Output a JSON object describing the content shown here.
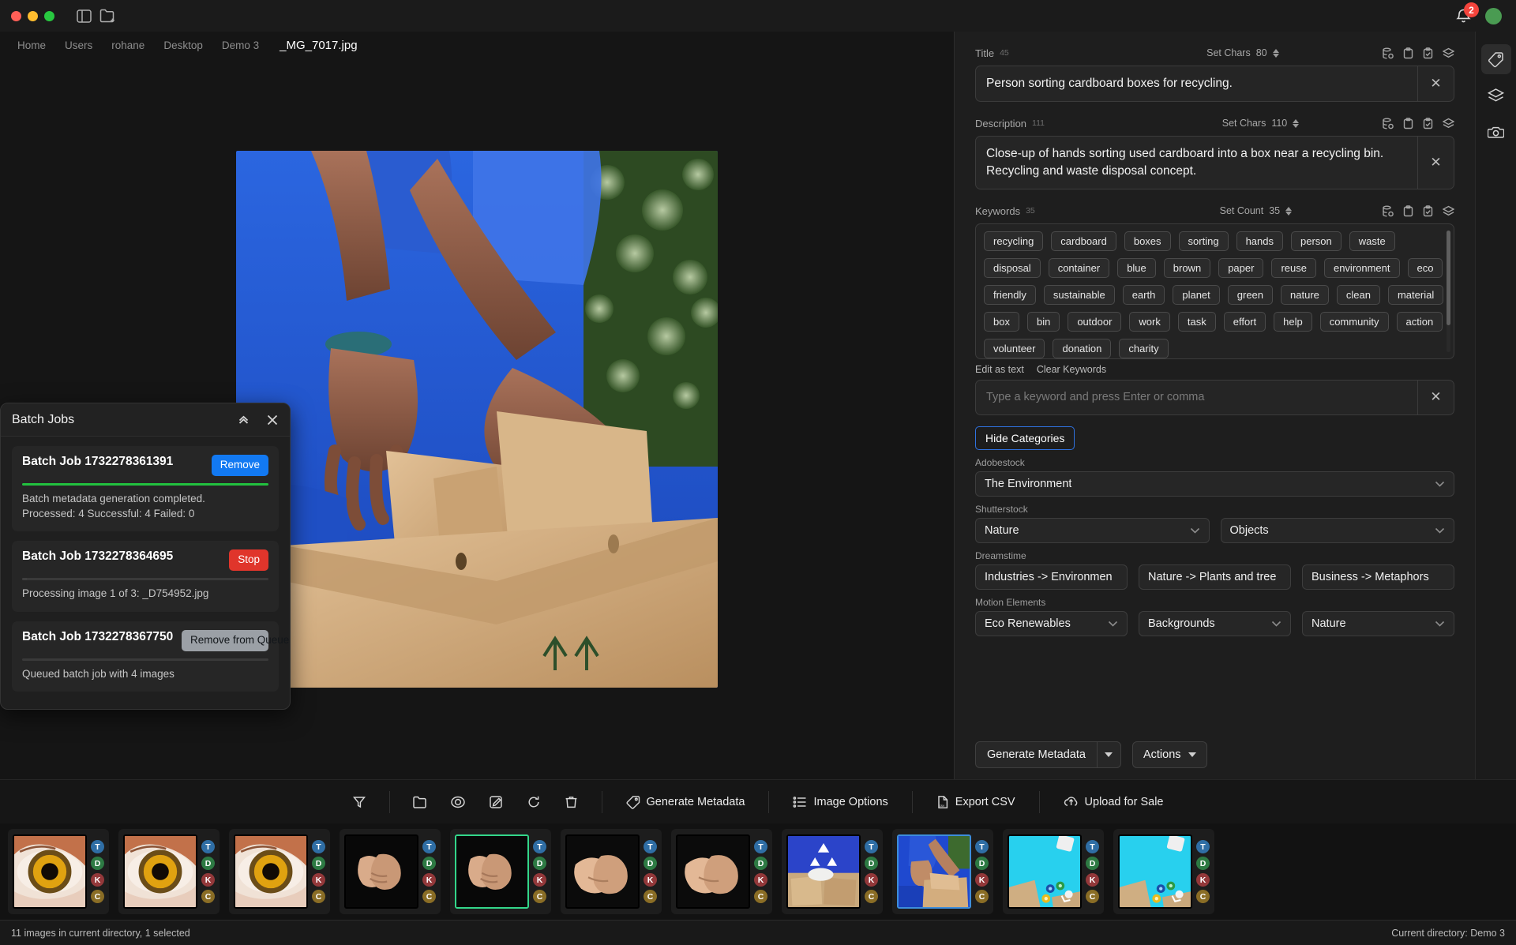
{
  "titlebar": {
    "sidebar_toggle_icon": "sidebar-panel-icon",
    "new_folder_icon": "new-folder-icon",
    "bell_icon": "bell-icon",
    "notification_count": "2"
  },
  "breadcrumb": {
    "crumbs": [
      "Home",
      "Users",
      "rohane",
      "Desktop",
      "Demo 3"
    ],
    "current": "_MG_7017.jpg"
  },
  "batch_panel": {
    "title": "Batch Jobs",
    "collapse_icon": "chevrons-up-icon",
    "close_icon": "close-icon",
    "jobs": [
      {
        "id": "Batch Job 1732278361391",
        "action_label": "Remove",
        "action_style": "blue",
        "progress": 100,
        "message": "Batch metadata generation completed.\nProcessed: 4 Successful: 4 Failed: 0"
      },
      {
        "id": "Batch Job 1732278364695",
        "action_label": "Stop",
        "action_style": "red",
        "progress": 2,
        "message": "Processing image 1 of 3: _D754952.jpg"
      },
      {
        "id": "Batch Job 1732278367750",
        "action_label": "Remove from Queue",
        "action_style": "grey",
        "progress": 0,
        "message": "Queued batch job with 4 images"
      }
    ]
  },
  "metadata": {
    "title_field": {
      "label": "Title",
      "count": "45",
      "set_label": "Set Chars",
      "set_value": "80",
      "value": "Person sorting cardboard boxes for recycling.",
      "clear_icon": "close-icon"
    },
    "description_field": {
      "label": "Description",
      "count": "111",
      "set_label": "Set Chars",
      "set_value": "110",
      "value": "Close-up of hands sorting used cardboard into a box near a recycling bin. Recycling and waste disposal concept.",
      "clear_icon": "close-icon"
    },
    "keywords_field": {
      "label": "Keywords",
      "count": "35",
      "set_label": "Set Count",
      "set_value": "35",
      "keywords": [
        "recycling",
        "cardboard",
        "boxes",
        "sorting",
        "hands",
        "person",
        "waste",
        "disposal",
        "container",
        "blue",
        "brown",
        "paper",
        "reuse",
        "environment",
        "eco",
        "friendly",
        "sustainable",
        "earth",
        "planet",
        "green",
        "nature",
        "clean",
        "material",
        "box",
        "bin",
        "outdoor",
        "work",
        "task",
        "effort",
        "help",
        "community",
        "action",
        "volunteer",
        "donation",
        "charity"
      ],
      "edit_as_text": "Edit as text",
      "clear_keywords": "Clear Keywords",
      "input_placeholder": "Type a keyword and press Enter or comma",
      "clear_icon": "close-icon"
    },
    "row_icons": [
      "database-save-icon",
      "clipboard-icon",
      "clipboard-check-icon",
      "layers-icon"
    ],
    "hide_categories_button": "Hide Categories",
    "category_groups": [
      {
        "label": "Adobestock",
        "selects": [
          {
            "value": "The Environment",
            "chevron": true
          }
        ]
      },
      {
        "label": "Shutterstock",
        "selects": [
          {
            "value": "Nature",
            "chevron": true
          },
          {
            "value": "Objects",
            "chevron": true
          }
        ]
      },
      {
        "label": "Dreamstime",
        "selects": [
          {
            "value": "Industries -> Environmen",
            "chevron": false
          },
          {
            "value": "Nature -> Plants and tree",
            "chevron": false
          },
          {
            "value": "Business -> Metaphors",
            "chevron": false
          }
        ]
      },
      {
        "label": "Motion Elements",
        "selects": [
          {
            "value": "Eco Renewables",
            "chevron": true
          },
          {
            "value": "Backgrounds",
            "chevron": true
          },
          {
            "value": "Nature",
            "chevron": true
          }
        ]
      }
    ],
    "generate_button": "Generate Metadata",
    "actions_button": "Actions"
  },
  "rail": {
    "items": [
      {
        "name": "tag-icon",
        "active": true
      },
      {
        "name": "layers-icon",
        "active": false
      },
      {
        "name": "camera-icon",
        "active": false
      }
    ]
  },
  "toolbar": {
    "icons": [
      "filter-icon",
      "folder-icon",
      "eye-icon",
      "edit-icon",
      "refresh-icon",
      "trash-icon"
    ],
    "buttons": [
      {
        "label": "Generate Metadata",
        "icon": "tag-icon"
      },
      {
        "label": "Image Options",
        "icon": "list-settings-icon"
      },
      {
        "label": "Export CSV",
        "icon": "csv-file-icon"
      },
      {
        "label": "Upload for Sale",
        "icon": "cloud-upload-icon"
      }
    ]
  },
  "filmstrip": {
    "badge_letters": [
      "T",
      "D",
      "K",
      "C"
    ],
    "thumbnails": [
      {
        "kind": "eye",
        "state": "none"
      },
      {
        "kind": "eye",
        "state": "none"
      },
      {
        "kind": "eye",
        "state": "none"
      },
      {
        "kind": "hands-dark",
        "state": "none"
      },
      {
        "kind": "hands-dark",
        "state": "green"
      },
      {
        "kind": "hands-light",
        "state": "none"
      },
      {
        "kind": "hands-light",
        "state": "none"
      },
      {
        "kind": "recycle-bin",
        "state": "none"
      },
      {
        "kind": "sorting-boxes",
        "state": "blue"
      },
      {
        "kind": "flatlay",
        "state": "none"
      },
      {
        "kind": "flatlay",
        "state": "none"
      }
    ]
  },
  "statusbar": {
    "left": "11 images in current directory, 1 selected",
    "right": "Current directory: Demo 3"
  }
}
